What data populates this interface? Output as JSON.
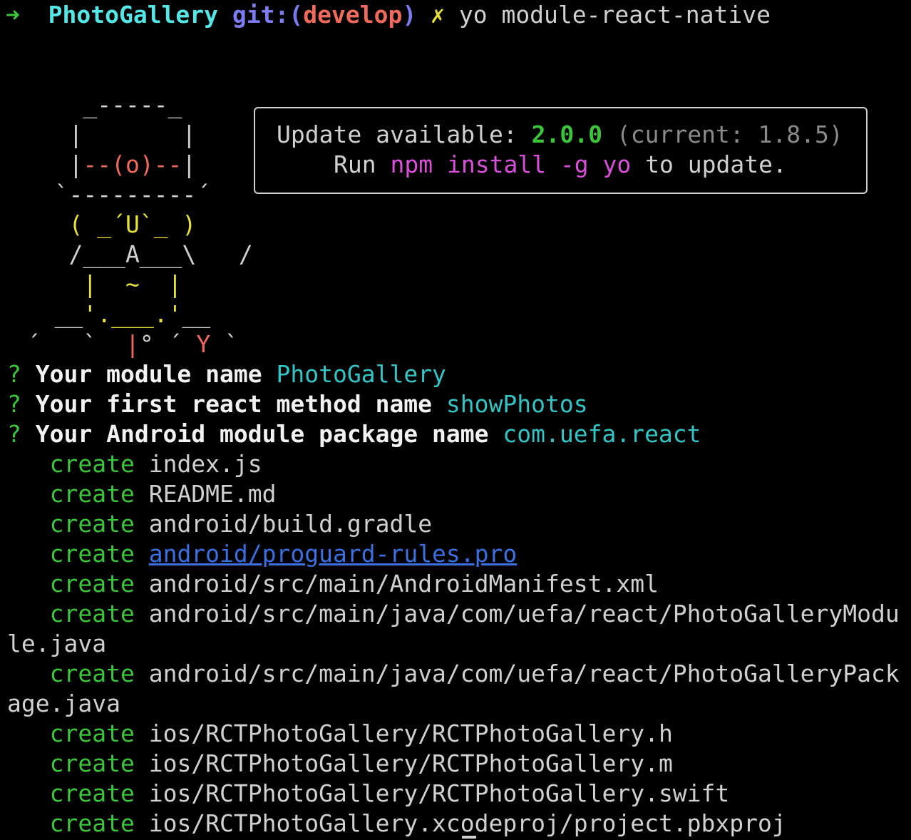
{
  "prompt": {
    "arrow": "➜",
    "dir": "PhotoGallery",
    "git_prefix": "git:(",
    "branch": "develop",
    "git_suffix": ")",
    "dirty": "✗",
    "command": "yo module-react-native"
  },
  "ascii_art": {
    "l1": "     _-----_",
    "l2": "    |       |",
    "l3a": "    |",
    "l3b": "--(o)--",
    "l3c": "|",
    "l4": "   `---------´",
    "l5": "    ( _´U`_ )",
    "l6": "    /___A___\\   /",
    "l7": "     |  ~  |",
    "l8a": "   __",
    "l8b": "'.___.'",
    "l8c": "__",
    "l9a": " ´   `  ",
    "l9b": "|",
    "l9c": "° ´ ",
    "l9d": "Y",
    "l9e": " `"
  },
  "update_box": {
    "label": "Update available:",
    "new_version": "2.0.0",
    "current": "(current: 1.8.5)",
    "run": "Run",
    "cmd_npm": "npm",
    "cmd_install": "install",
    "cmd_flag": "-g",
    "cmd_yo": "yo",
    "tail": "to update."
  },
  "questions": [
    {
      "mark": "?",
      "q": "Your module name",
      "a": "PhotoGallery"
    },
    {
      "mark": "?",
      "q": "Your first react method name",
      "a": "showPhotos"
    },
    {
      "mark": "?",
      "q": "Your Android module package name",
      "a": "com.uefa.react"
    }
  ],
  "creates": {
    "verb": "create",
    "files": [
      "index.js",
      "README.md",
      "android/build.gradle",
      "android/proguard-rules.pro",
      "android/src/main/AndroidManifest.xml",
      "android/src/main/java/com/uefa/react/PhotoGalleryModu",
      "le.java",
      "android/src/main/java/com/uefa/react/PhotoGalleryPack",
      "age.java",
      "ios/RCTPhotoGallery/RCTPhotoGallery.h",
      "ios/RCTPhotoGallery/RCTPhotoGallery.m",
      "ios/RCTPhotoGallery/RCTPhotoGallery.swift",
      "ios/RCTPhotoGallery.xcodeproj/project.pbxproj"
    ]
  },
  "colors": {
    "background": "#000000",
    "text": "#d0d0d0",
    "green": "#3cc43c",
    "cyan": "#55e6e6",
    "red": "#ef6a5a",
    "yellow": "#e6e23a",
    "link": "#3c6fe0"
  }
}
